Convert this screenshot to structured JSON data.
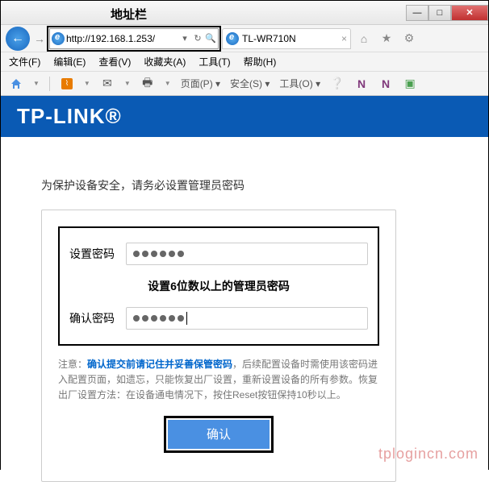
{
  "window": {
    "min": "—",
    "max": "□",
    "close": "✕"
  },
  "nav": {
    "address_label": "地址栏",
    "url": "http://192.168.1.253/",
    "tab_title": "TL-WR710N"
  },
  "menu": {
    "file": "文件(F)",
    "edit": "编辑(E)",
    "view": "查看(V)",
    "favorites": "收藏夹(A)",
    "tools": "工具(T)",
    "help": "帮助(H)"
  },
  "toolbar": {
    "page": "页面(P)",
    "safety": "安全(S)",
    "tools": "工具(O)"
  },
  "brand": "TP-LINK®",
  "page": {
    "prompt": "为保护设备安全，请务必设置管理员密码",
    "set_pwd_label": "设置密码",
    "hint": "设置6位数以上的管理员密码",
    "confirm_pwd_label": "确认密码",
    "notice_label": "注意：",
    "notice_bold": "确认提交前请记住并妥善保管密码",
    "notice_rest": "，后续配置设备时需使用该密码进入配置页面，如遗忘，只能恢复出厂设置，重新设置设备的所有参数。恢复出厂设置方法：在设备通电情况下，按住Reset按钮保持10秒以上。",
    "submit": "确认"
  },
  "watermark": "tplogincn.com"
}
